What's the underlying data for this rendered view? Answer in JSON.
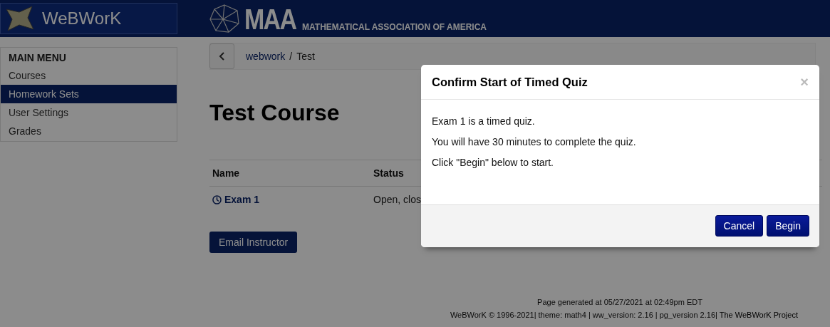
{
  "header": {
    "brand": "WeBWorK",
    "org_short": "MAA",
    "org_full": "MATHEMATICAL ASSOCIATION OF AMERICA"
  },
  "sidebar": {
    "heading": "MAIN MENU",
    "items": [
      {
        "label": "Courses",
        "selected": false
      },
      {
        "label": "Homework Sets",
        "selected": true
      },
      {
        "label": "User Settings",
        "selected": false
      },
      {
        "label": "Grades",
        "selected": false
      }
    ]
  },
  "breadcrumb": {
    "items": [
      "webwork",
      "Test"
    ],
    "separator": "/"
  },
  "page_title": "Test Course",
  "table": {
    "columns": [
      "Name",
      "Status"
    ],
    "rows": [
      {
        "name": "Exam 1",
        "status": "Open, clos"
      }
    ]
  },
  "email_button": "Email Instructor",
  "footer": {
    "generated": "Page generated at 05/27/2021 at 02:49pm EDT",
    "info": "WeBWorK © 1996-2021| theme: math4 | ww_version: 2.16 | pg_version 2.16|",
    "link": "The WeBWorK Project"
  },
  "modal": {
    "title": "Confirm Start of Timed Quiz",
    "close": "×",
    "paragraphs": [
      "Exam 1 is a timed quiz.",
      "You will have 30 minutes to complete the quiz.",
      "Click \"Begin\" below to start."
    ],
    "buttons": [
      "Cancel",
      "Begin"
    ]
  }
}
